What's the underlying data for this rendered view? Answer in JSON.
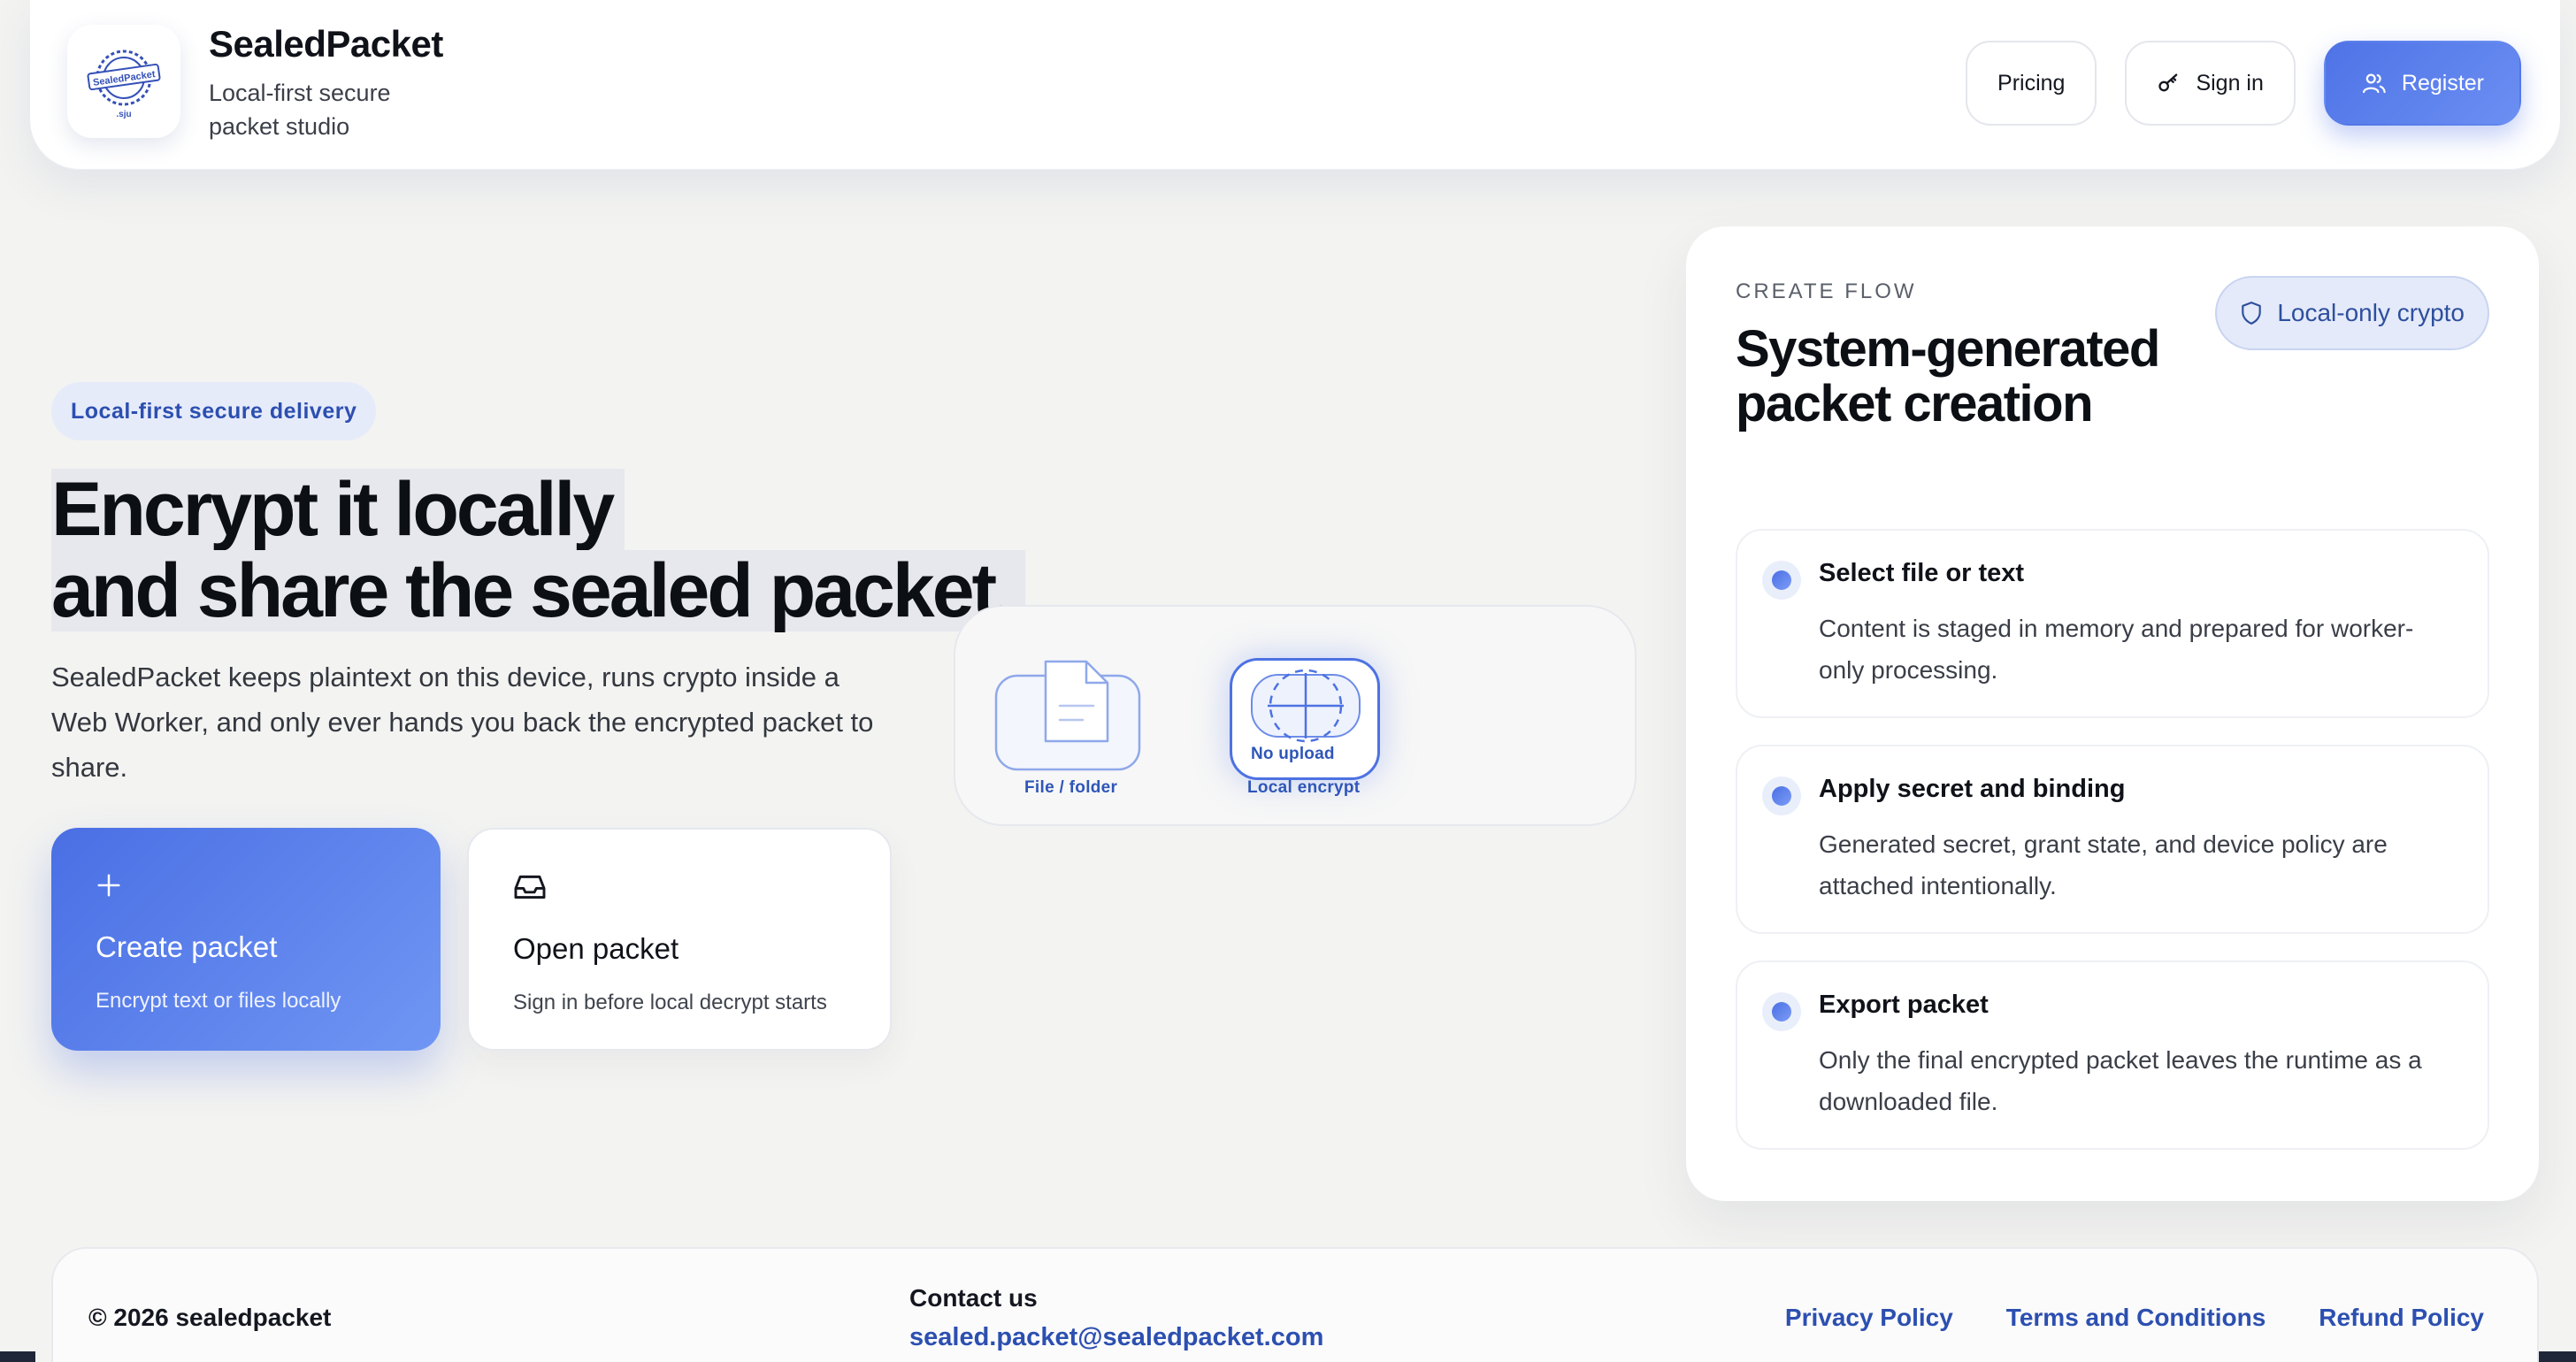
{
  "brand": {
    "name": "SealedPacket",
    "tagline": "Local-first secure packet studio",
    "logo_text_top": "SealedPacket",
    "logo_text_bottom": ".sju"
  },
  "nav": {
    "pricing": "Pricing",
    "sign_in": "Sign in",
    "register": "Register"
  },
  "hero": {
    "badge": "Local-first secure delivery",
    "headline_line1": "Encrypt it locally",
    "headline_line2": "and share the sealed packet.",
    "lede": "SealedPacket keeps plaintext on this device, runs crypto inside a Web Worker, and only ever hands you back the encrypted packet to share."
  },
  "actions": {
    "create": {
      "title": "Create packet",
      "subtitle": "Encrypt text or files locally"
    },
    "open": {
      "title": "Open packet",
      "subtitle": "Sign in before local decrypt starts"
    }
  },
  "illustration": {
    "file_label": "File / folder",
    "encrypt_label": "Local encrypt",
    "no_upload": "No upload"
  },
  "flow": {
    "eyebrow": "CREATE FLOW",
    "title": "System-generated packet creation",
    "pill": "Local-only crypto",
    "steps": [
      {
        "title": "Select file or text",
        "desc": "Content is staged in memory and prepared for worker-only processing."
      },
      {
        "title": "Apply secret and binding",
        "desc": "Generated secret, grant state, and device policy are attached intentionally."
      },
      {
        "title": "Export packet",
        "desc": "Only the final encrypted packet leaves the runtime as a downloaded file."
      }
    ]
  },
  "footer": {
    "copyright": "© 2026 sealedpacket",
    "contact_label": "Contact us",
    "contact_email": "sealed.packet@sealedpacket.com",
    "links": [
      "Privacy Policy",
      "Terms and Conditions",
      "Refund Policy"
    ]
  },
  "colors": {
    "accent": "#4f73e6",
    "link": "#2c4fb0",
    "background": "#f3f3f1"
  }
}
